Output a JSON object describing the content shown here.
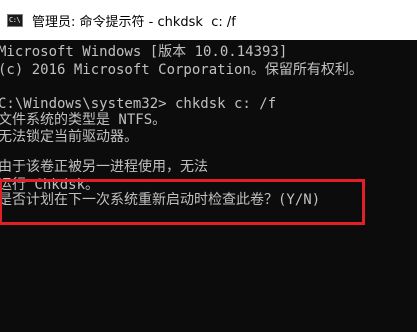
{
  "window": {
    "title": "管理员: 命令提示符 - chkdsk  c: /f",
    "icon": "command-prompt-icon",
    "icon_glyph": "C:\\"
  },
  "console": {
    "lines": [
      "Microsoft Windows [版本 10.0.14393]",
      "(c) 2016 Microsoft Corporation。保留所有权利。",
      "",
      "C:\\Windows\\system32> chkdsk c: /f",
      "文件系统的类型是 NTFS。",
      "无法锁定当前驱动器。",
      "",
      "由于该卷正被另一进程使用，无法",
      "运行 Chkdsk。",
      "是否计划在下一次系统重新启动时检查此卷？(Y/N)"
    ]
  },
  "colors": {
    "console_background": "#0c0c0c",
    "console_text": "#c0c0c0",
    "titlebar_background": "#ffffff",
    "annotation_border": "#e21f26"
  }
}
